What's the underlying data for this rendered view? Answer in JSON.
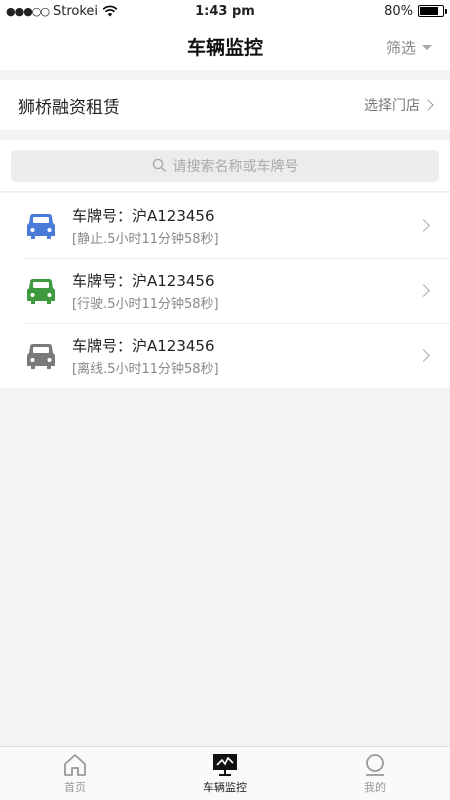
{
  "status_bar": {
    "signal": "●●●○○",
    "carrier": "Strokei",
    "time": "1:43 pm",
    "battery_percent": "80%",
    "battery_level": 0.8
  },
  "nav": {
    "title": "车辆监控",
    "filter_label": "筛选"
  },
  "store": {
    "company": "狮桥融资租赁",
    "select_label": "选择门店"
  },
  "search": {
    "placeholder": "请搜索名称或车牌号"
  },
  "vehicles": [
    {
      "plate": "车牌号：沪A123456",
      "status": "[静止.5小时11分钟58秒]",
      "color": "#4a7bd8"
    },
    {
      "plate": "车牌号：沪A123456",
      "status": "[行驶.5小时11分钟58秒]",
      "color": "#3f9a3f"
    },
    {
      "plate": "车牌号：沪A123456",
      "status": "[离线.5小时11分钟58秒]",
      "color": "#7a7a7a"
    }
  ],
  "tabs": [
    {
      "label": "首页",
      "icon": "home-icon",
      "active": false
    },
    {
      "label": "车辆监控",
      "icon": "monitor-icon",
      "active": true
    },
    {
      "label": "我的",
      "icon": "profile-icon",
      "active": false
    }
  ]
}
